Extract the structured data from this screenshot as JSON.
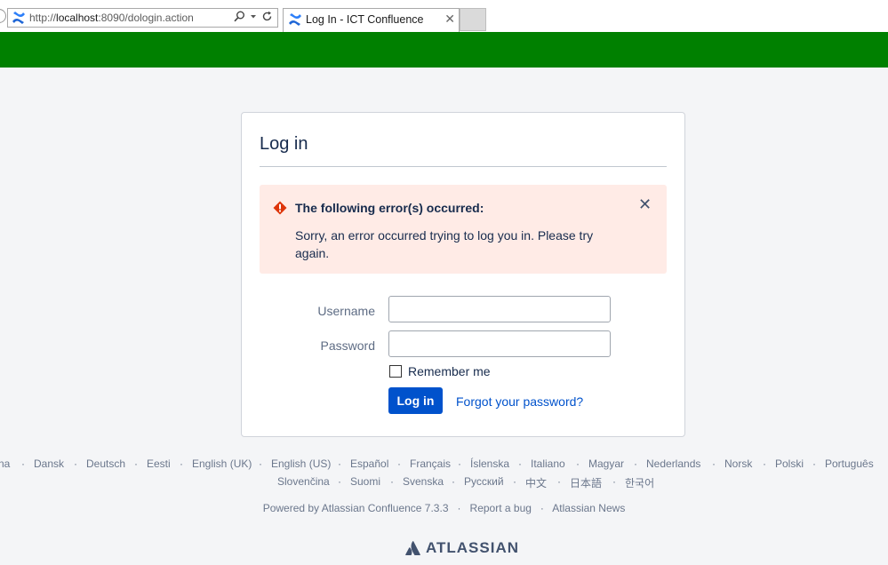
{
  "browser": {
    "address_prefix": "http://",
    "address_host": "localhost",
    "address_rest": ":8090/dologin.action",
    "tab_title": "Log In - ICT Confluence",
    "tab_close": "✕",
    "search_icon": "search-icon",
    "refresh_icon": "refresh-icon"
  },
  "login": {
    "title": "Log in",
    "error_heading": "The following error(s) occurred:",
    "error_message": "Sorry, an error occurred trying to log you in. Please try again.",
    "error_close": "✕",
    "username_label": "Username",
    "username_value": "",
    "password_label": "Password",
    "password_value": "",
    "remember_label": "Remember me",
    "remember_checked": false,
    "login_button": "Log in",
    "forgot_link": "Forgot your password?"
  },
  "footer": {
    "languages_row1": [
      "na",
      "Dansk",
      "Deutsch",
      "Eesti",
      "English (UK)",
      "English (US)",
      "Español",
      "Français",
      "Íslenska",
      "Italiano",
      "Magyar",
      "Nederlands",
      "Norsk",
      "Polski",
      "Português"
    ],
    "languages_row2": [
      "Slovenčina",
      "Suomi",
      "Svenska",
      "Русский",
      "中文",
      "日本語",
      "한국어"
    ],
    "powered_by": "Powered by Atlassian Confluence 7.3.3",
    "report_bug": "Report a bug",
    "atlassian_news": "Atlassian News",
    "logo_text": "ATLASSIAN"
  },
  "colors": {
    "header_green": "#008000",
    "primary_blue": "#0052cc",
    "error_bg": "#ffebe6",
    "error_icon": "#de350b"
  }
}
